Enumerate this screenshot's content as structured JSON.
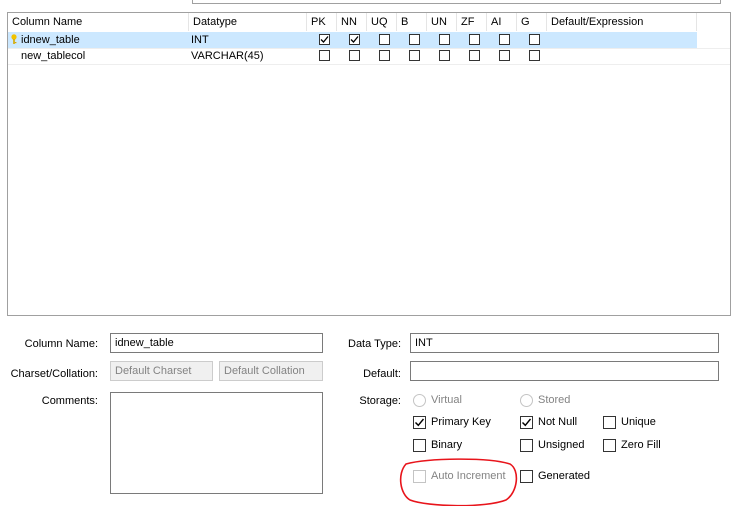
{
  "grid": {
    "headers": {
      "column_name": "Column Name",
      "datatype": "Datatype",
      "pk": "PK",
      "nn": "NN",
      "uq": "UQ",
      "b": "B",
      "un": "UN",
      "zf": "ZF",
      "ai": "AI",
      "g": "G",
      "default": "Default/Expression"
    },
    "rows": [
      {
        "name": "idnew_table",
        "type": "INT",
        "default": "",
        "selected": true,
        "primary_key_icon": "key-icon",
        "flags": {
          "pk": true,
          "nn": true,
          "uq": false,
          "b": false,
          "un": false,
          "zf": false,
          "ai": false,
          "g": false
        }
      },
      {
        "name": "new_tablecol",
        "type": "VARCHAR(45)",
        "default": "",
        "selected": false,
        "flags": {
          "pk": false,
          "nn": false,
          "uq": false,
          "b": false,
          "un": false,
          "zf": false,
          "ai": false,
          "g": false
        }
      }
    ]
  },
  "form": {
    "column_name_label": "Column Name:",
    "column_name_value": "idnew_table",
    "charset_label": "Charset/Collation:",
    "charset_value": "Default Charset",
    "collation_value": "Default Collation",
    "comments_label": "Comments:",
    "data_type_label": "Data Type:",
    "data_type_value": "INT",
    "default_label": "Default:",
    "default_value": "",
    "storage_label": "Storage:",
    "virtual_label": "Virtual",
    "stored_label": "Stored",
    "primary_key_label": "Primary Key",
    "not_null_label": "Not Null",
    "unique_label": "Unique",
    "binary_label": "Binary",
    "unsigned_label": "Unsigned",
    "zero_fill_label": "Zero Fill",
    "auto_increment_label": "Auto Increment",
    "generated_label": "Generated"
  },
  "states": {
    "primary_key": true,
    "not_null": true,
    "unique": false,
    "binary": false,
    "unsigned": false,
    "zero_fill": false,
    "auto_increment": false,
    "generated": false,
    "auto_increment_disabled": true,
    "storage_disabled": true
  },
  "colors": {
    "selection": "#cce8ff",
    "annotation": "#e8141b",
    "disabled_text": "#838383"
  }
}
